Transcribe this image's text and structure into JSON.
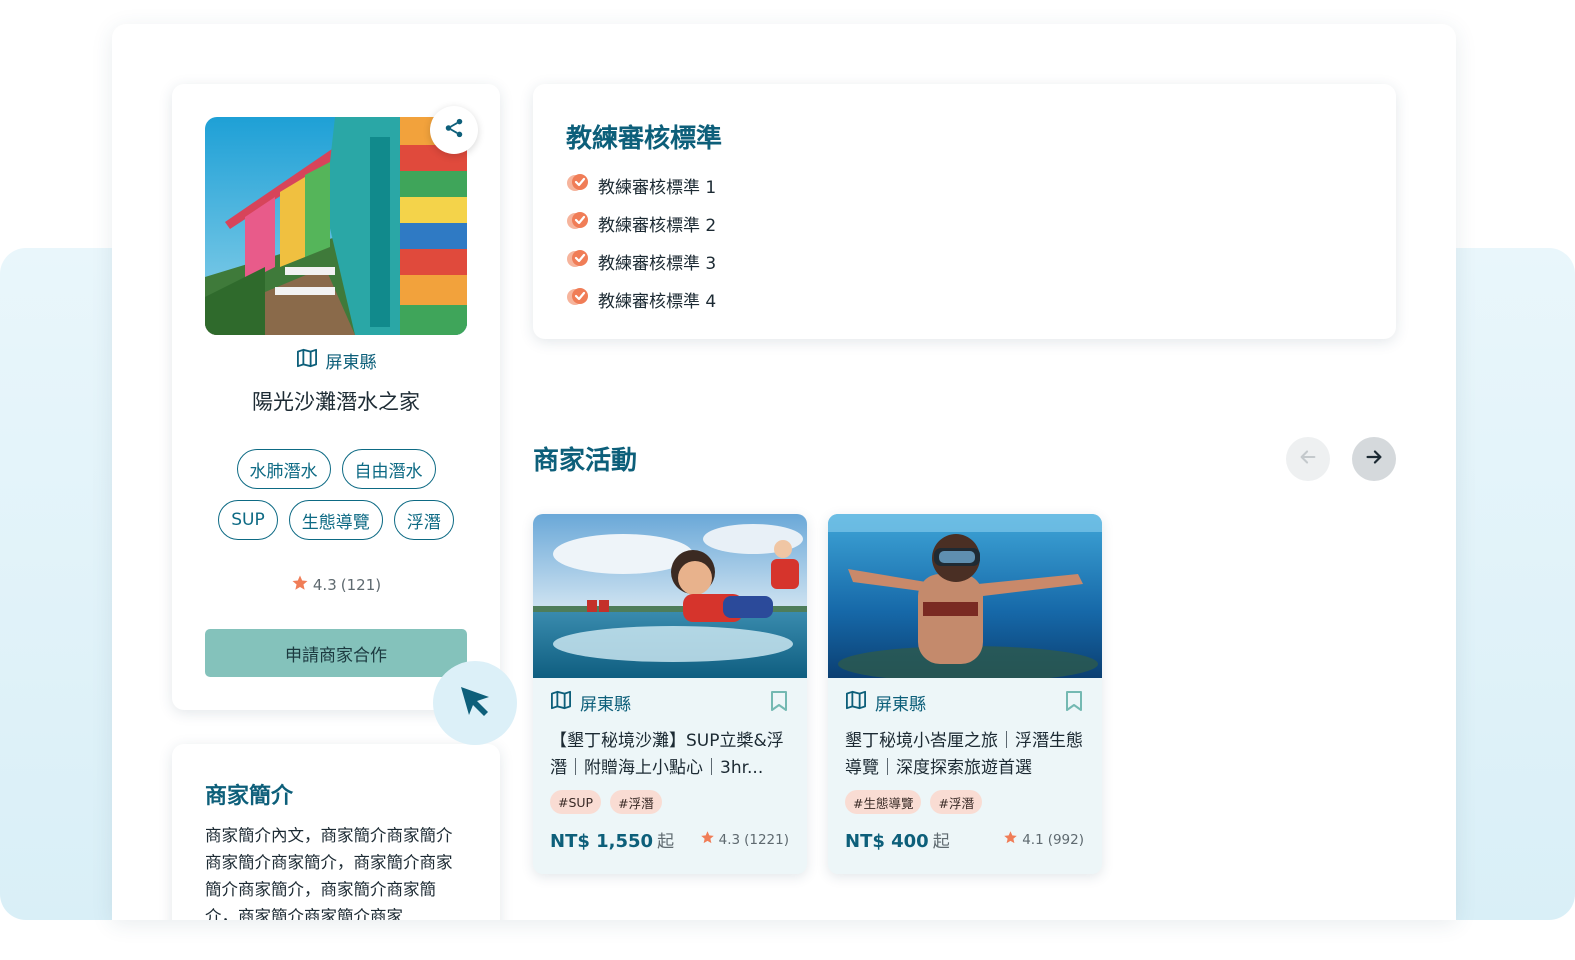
{
  "merchant": {
    "location": "屏東縣",
    "name": "陽光沙灘潛水之家",
    "tags_row1": [
      "水肺潛水",
      "自由潛水"
    ],
    "tags_row2": [
      "SUP",
      "生態導覽",
      "浮潛"
    ],
    "rating": "4.3",
    "review_count": "(121)",
    "apply_label": "申請商家合作"
  },
  "intro": {
    "title": "商家簡介",
    "text": "商家簡介內文，商家簡介商家簡介商家簡介商家簡介，商家簡介商家簡介商家簡介，商家簡介商家簡介，商家簡介商家簡介商家"
  },
  "standards": {
    "title": "教練審核標準",
    "items": [
      "教練審核標準 1",
      "教練審核標準 2",
      "教練審核標準 3",
      "教練審核標準 4"
    ]
  },
  "activities": {
    "title": "商家活動",
    "cards": [
      {
        "location": "屏東縣",
        "title": "【墾丁秘境沙灘】SUP立槳&浮潛｜附贈海上小點心｜3hr...",
        "tags": [
          "#SUP",
          "#浮潛"
        ],
        "price": "NT$ 1,550",
        "price_suffix": "起",
        "rating": "4.3",
        "reviews": "(1221)"
      },
      {
        "location": "屏東縣",
        "title": "墾丁秘境小峇厘之旅｜浮潛生態導覽｜深度探索旅遊首選",
        "tags": [
          "#生態導覽",
          "#浮潛"
        ],
        "price": "NT$ 400",
        "price_suffix": "起",
        "rating": "4.1",
        "reviews": "(992)"
      }
    ]
  },
  "colors": {
    "brand": "#0d5f7a",
    "accent": "#f07d57",
    "button": "#84c2bb",
    "tag_bg": "#f9dcd3"
  },
  "icons": {
    "share": "share-icon",
    "map": "map-icon",
    "star": "star-icon",
    "check": "check-badge-icon",
    "bookmark": "bookmark-icon",
    "arrow_left": "arrow-left-icon",
    "arrow_right": "arrow-right-icon",
    "cursor": "cursor-arrow-icon"
  }
}
